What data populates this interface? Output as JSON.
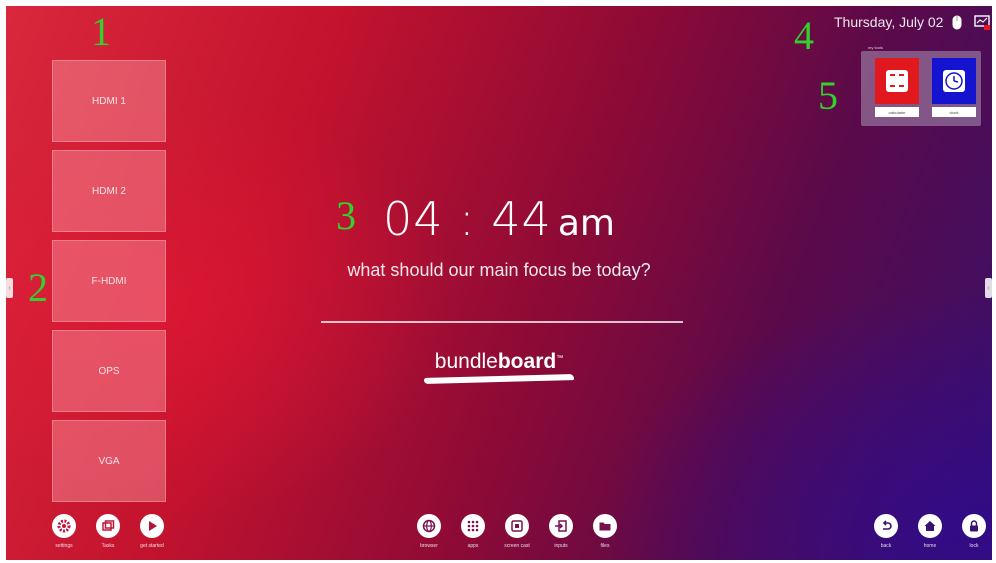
{
  "annotations": [
    "1",
    "2",
    "3",
    "4",
    "5"
  ],
  "sources": [
    "HDMI 1",
    "HDMI 2",
    "F-HDMI",
    "OPS",
    "VGA"
  ],
  "clock": {
    "time": "04 : 44",
    "ampm": "am"
  },
  "focus": {
    "question": "what should our main focus be today?"
  },
  "brand": {
    "light": "bundle",
    "bold": "board",
    "tm": "™"
  },
  "status": {
    "date": "Thursday, July 02"
  },
  "tools": {
    "title": "my tools",
    "items": [
      {
        "label": "calculator",
        "icon": "calculator-icon",
        "color": "#e1191e"
      },
      {
        "label": "clock",
        "icon": "clock-icon",
        "color": "#1414d0"
      }
    ]
  },
  "dock": {
    "left": [
      {
        "label": "settings",
        "icon": "gear-icon"
      },
      {
        "label": "Tasks",
        "icon": "windows-icon"
      },
      {
        "label": "get started",
        "icon": "play-icon"
      }
    ],
    "center": [
      {
        "label": "browser",
        "icon": "globe-icon"
      },
      {
        "label": "apps",
        "icon": "apps-grid-icon"
      },
      {
        "label": "screen cast",
        "icon": "screen-cast-icon"
      },
      {
        "label": "inputs",
        "icon": "input-icon"
      },
      {
        "label": "files",
        "icon": "folder-icon"
      }
    ],
    "right": [
      {
        "label": "back",
        "icon": "back-icon"
      },
      {
        "label": "home",
        "icon": "home-icon"
      },
      {
        "label": "lock",
        "icon": "lock-icon"
      }
    ]
  },
  "colors": {
    "annotation": "#33d12e",
    "calculator": "#e1191e",
    "clock": "#1414d0"
  }
}
